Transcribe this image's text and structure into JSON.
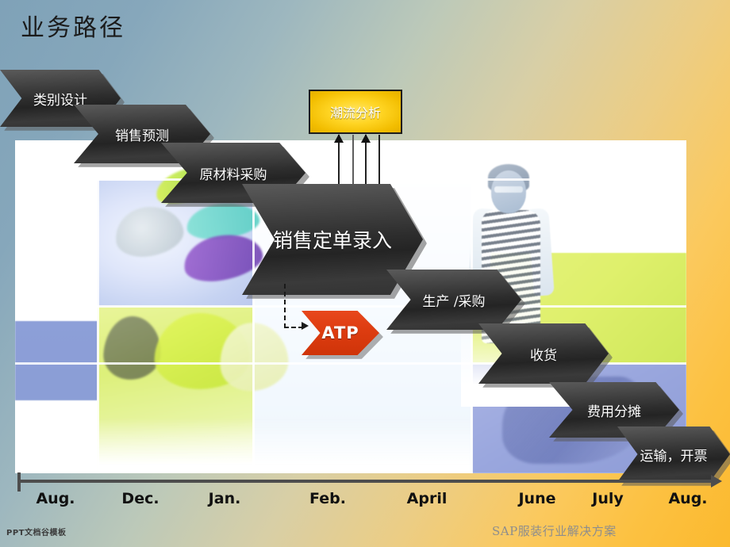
{
  "slide": {
    "title": "业务路径"
  },
  "process_steps": [
    {
      "label": "类别设计"
    },
    {
      "label": "销售预测"
    },
    {
      "label": "原材料采购"
    },
    {
      "label": "销售定单录入"
    },
    {
      "label": "生产 /采购"
    },
    {
      "label": "收货"
    },
    {
      "label": "费用分摊"
    },
    {
      "label": "运输，开票"
    }
  ],
  "trend_box": {
    "label": "潮流分析",
    "fill_color": "#ffd524",
    "border_color": "#1d1d1d"
  },
  "atp": {
    "label": "ATP",
    "fill_color": "#dd3c10"
  },
  "arrows": {
    "count": 4,
    "directions": [
      "up",
      "down",
      "up",
      "down"
    ]
  },
  "timeline": {
    "labels": [
      "Aug.",
      "Dec.",
      "Jan.",
      "Feb.",
      "April",
      "June",
      "July",
      "Aug."
    ],
    "axis_color": "#4d4d4d"
  },
  "footer": {
    "logo_text": "PPT文档谷模板",
    "right_text": "SAP服装行业解决方案"
  },
  "theme": {
    "background_start": "#7fa2b8",
    "background_end": "#fbb92e",
    "chevron_color": "#2e2e2e",
    "title_color": "#1b1b1b"
  }
}
